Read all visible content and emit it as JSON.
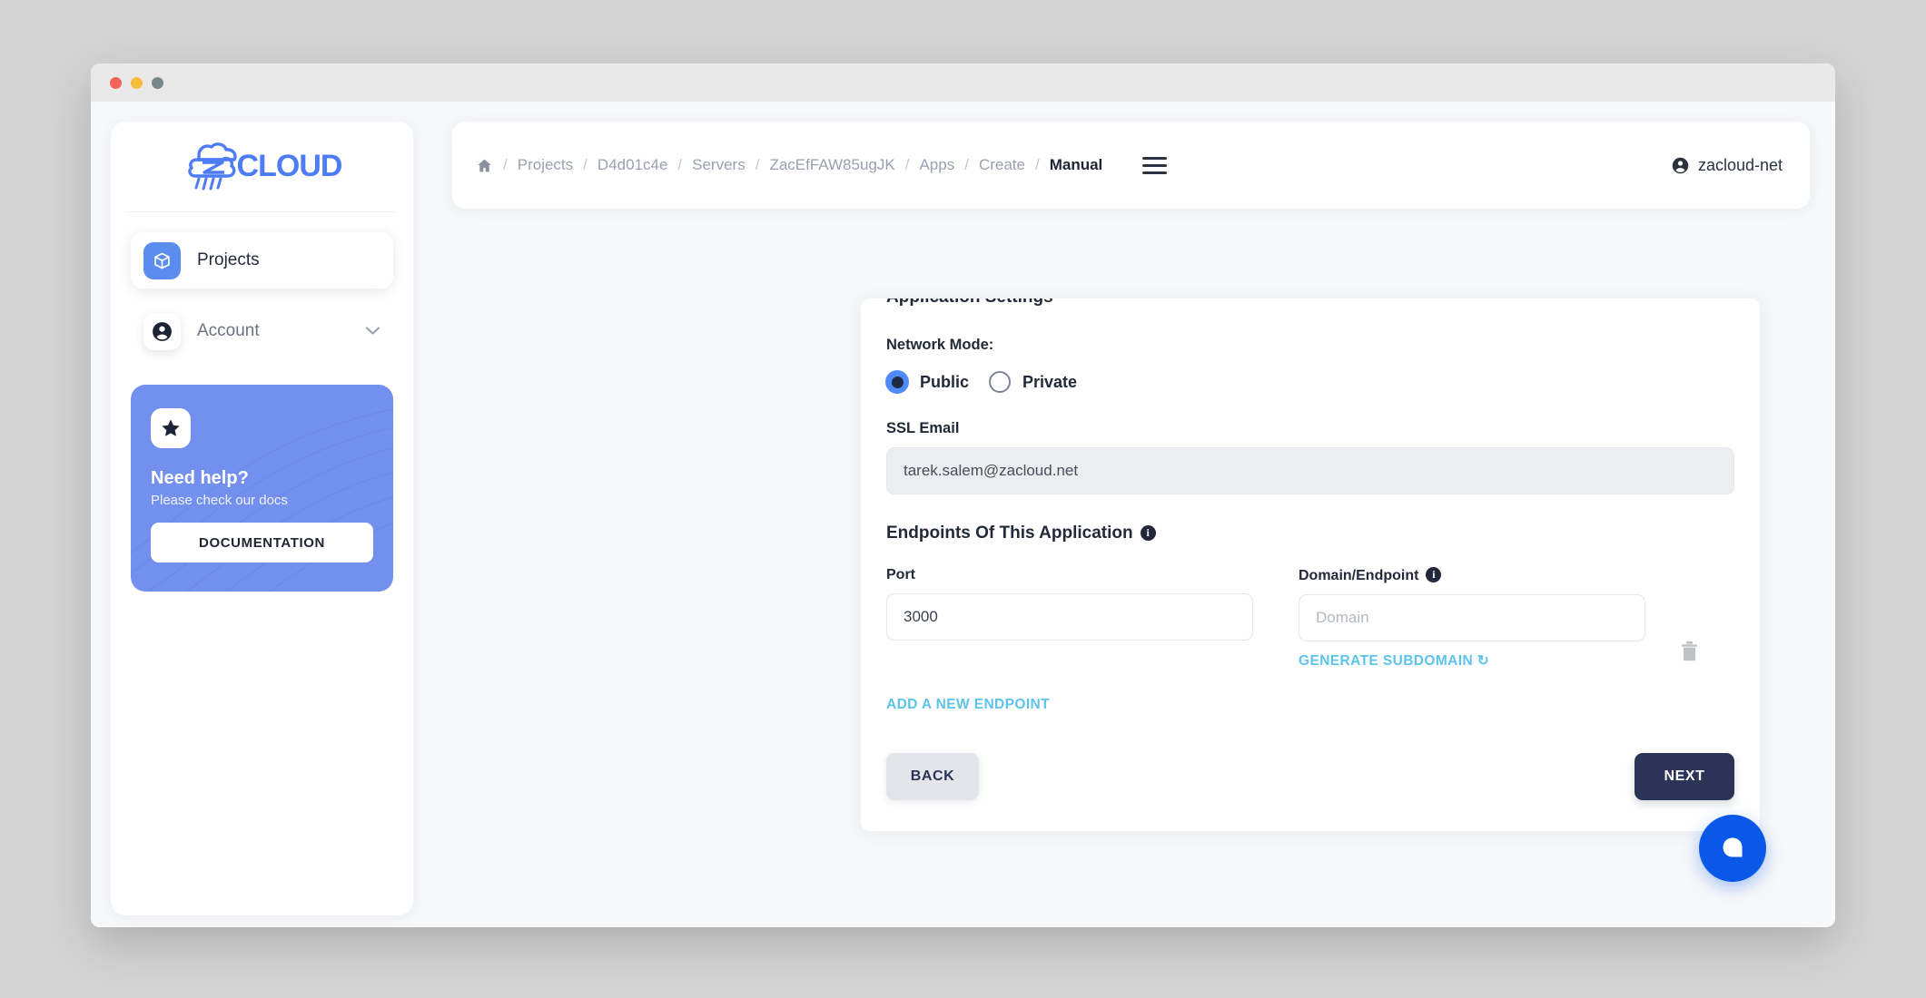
{
  "window": {
    "traffic_lights": [
      "close",
      "minimize",
      "zoom"
    ],
    "colors": {
      "close": "#f4635c",
      "minimize": "#f6bd3b",
      "zoom": "#78888a"
    }
  },
  "sidebar": {
    "logo_text": "CLOUD",
    "logo_mark": "ZA",
    "items": [
      {
        "label": "Projects",
        "icon": "cube-icon",
        "active": true
      },
      {
        "label": "Account",
        "icon": "account-circle-icon",
        "active": false,
        "chevron": "chevron-down-icon"
      }
    ],
    "help_card": {
      "icon": "star-icon",
      "title": "Need help?",
      "subtitle": "Please check our docs",
      "button_label": "DOCUMENTATION"
    }
  },
  "topbar": {
    "home_icon": "home-icon",
    "breadcrumbs": [
      {
        "label": "Projects",
        "current": false
      },
      {
        "label": "D4d01c4e",
        "current": false
      },
      {
        "label": "Servers",
        "current": false
      },
      {
        "label": "ZacEfFAW85ugJK",
        "current": false
      },
      {
        "label": "Apps",
        "current": false
      },
      {
        "label": "Create",
        "current": false
      },
      {
        "label": "Manual",
        "current": true
      }
    ],
    "separator": "/",
    "menu_icon": "hamburger-menu-icon",
    "user": {
      "icon": "account-circle-icon",
      "name": "zacloud-net"
    }
  },
  "form": {
    "clipped_heading": "Application Settings",
    "network_mode": {
      "label": "Network Mode:",
      "options": [
        {
          "label": "Public",
          "selected": true
        },
        {
          "label": "Private",
          "selected": false
        }
      ],
      "selected_color": "#4f8bf8"
    },
    "ssl_email": {
      "label": "SSL Email",
      "value": "tarek.salem@zacloud.net",
      "placeholder": "SSL Email",
      "disabled": true
    },
    "endpoints": {
      "section_title": "Endpoints Of This Application",
      "section_info_icon": "info-icon",
      "port_label": "Port",
      "domain_label": "Domain/Endpoint",
      "domain_info_icon": "info-icon",
      "rows": [
        {
          "port_value": "3000",
          "port_placeholder": "Port",
          "domain_value": "",
          "domain_placeholder": "Domain",
          "delete_icon": "trash-icon"
        }
      ],
      "generate_subdomain_label": "GENERATE SUBDOMAIN ↻",
      "add_endpoint_label": "ADD A NEW ENDPOINT"
    },
    "actions": {
      "back_label": "BACK",
      "next_label": "NEXT"
    }
  },
  "chat_widget": {
    "icon": "chat-bubble-icon",
    "color": "#0a58e8"
  }
}
